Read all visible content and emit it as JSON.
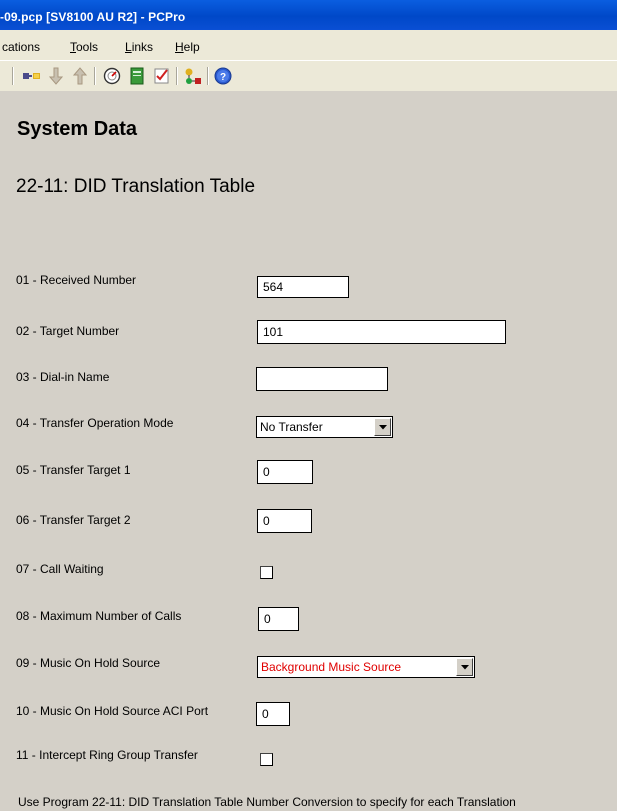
{
  "window": {
    "title": "-09.pcp [SV8100 AU R2] - PCPro"
  },
  "menu": {
    "items": [
      "cations",
      "Tools",
      "Links",
      "Help"
    ]
  },
  "toolbar": {
    "icons": [
      "connect-icon",
      "download-arrow-icon",
      "upload-arrow-icon",
      "gauge-icon",
      "book-icon",
      "checklist-icon",
      "network-icon",
      "help-icon"
    ]
  },
  "page": {
    "section_title": "System Data",
    "heading": "22-11: DID Translation Table",
    "footer": "Use Program 22-11: DID Translation Table Number Conversion to specify for each Translation"
  },
  "fields": {
    "received_number": {
      "label": "01 - Received Number",
      "value": "564"
    },
    "target_number": {
      "label": "02 - Target Number",
      "value": "101"
    },
    "dial_in_name": {
      "label": "03 - Dial-in Name",
      "value": ""
    },
    "transfer_operation_mode": {
      "label": "04 - Transfer Operation Mode",
      "value": "No Transfer"
    },
    "transfer_target_1": {
      "label": "05 - Transfer Target 1",
      "value": "0"
    },
    "transfer_target_2": {
      "label": "06 - Transfer Target 2",
      "value": "0"
    },
    "call_waiting": {
      "label": "07 - Call Waiting",
      "checked": false
    },
    "max_calls": {
      "label": "08 - Maximum Number of Calls",
      "value": "0"
    },
    "moh_source": {
      "label": "09 - Music On Hold Source",
      "value": "Background Music Source",
      "value_color": "#e00000"
    },
    "moh_aci_port": {
      "label": "10 - Music On Hold Source ACI Port",
      "value": "0"
    },
    "intercept_ring_group": {
      "label": "11 - Intercept Ring Group Transfer",
      "checked": false
    }
  }
}
